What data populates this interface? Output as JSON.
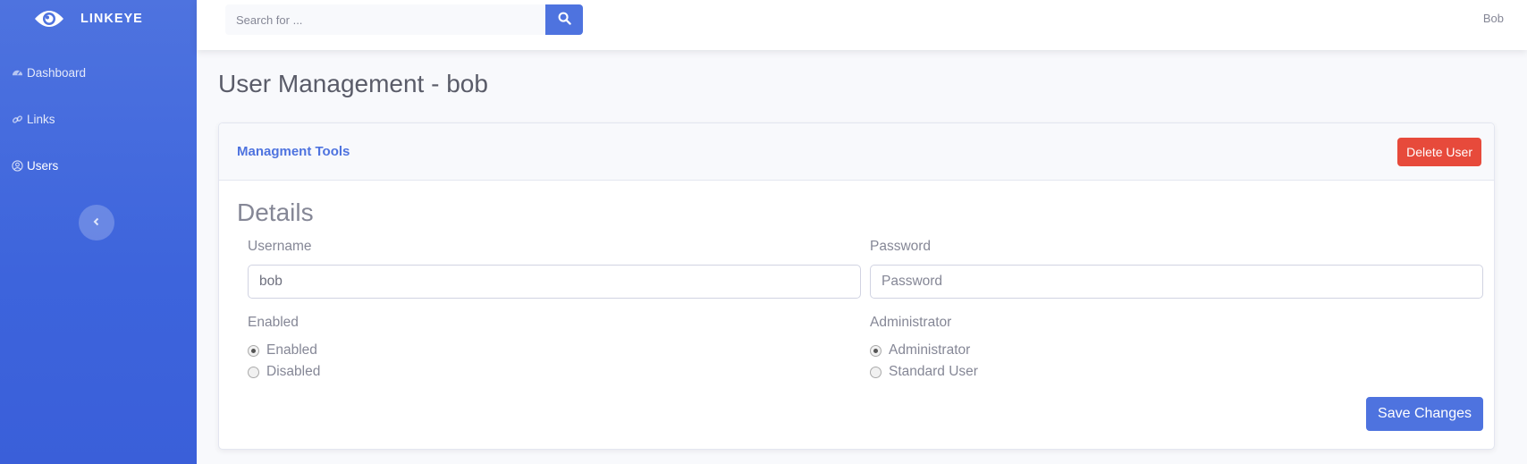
{
  "brand": {
    "name": "LINKEYE",
    "icon": "eye-icon"
  },
  "sidebar": {
    "items": [
      {
        "label": "Dashboard",
        "icon": "tachometer-icon",
        "active": false
      },
      {
        "label": "Links",
        "icon": "link-icon",
        "active": false
      },
      {
        "label": "Users",
        "icon": "user-circle-icon",
        "active": true
      }
    ],
    "toggle_icon": "chevron-left-icon"
  },
  "topbar": {
    "search_placeholder": "Search for ...",
    "search_icon": "search-icon",
    "user": "Bob"
  },
  "page": {
    "title": "User Management - bob"
  },
  "card": {
    "header_title": "Managment Tools",
    "delete_label": "Delete User",
    "details_heading": "Details",
    "username_label": "Username",
    "username_value": "bob",
    "password_label": "Password",
    "password_placeholder": "Password",
    "enabled_label": "Enabled",
    "enabled_options": [
      "Enabled",
      "Disabled"
    ],
    "enabled_selected": "Enabled",
    "admin_label": "Administrator",
    "admin_options": [
      "Administrator",
      "Standard User"
    ],
    "admin_selected": "Administrator",
    "save_label": "Save Changes"
  },
  "colors": {
    "primary": "#4e73df",
    "danger": "#e74a3b",
    "text_muted": "#858796"
  }
}
